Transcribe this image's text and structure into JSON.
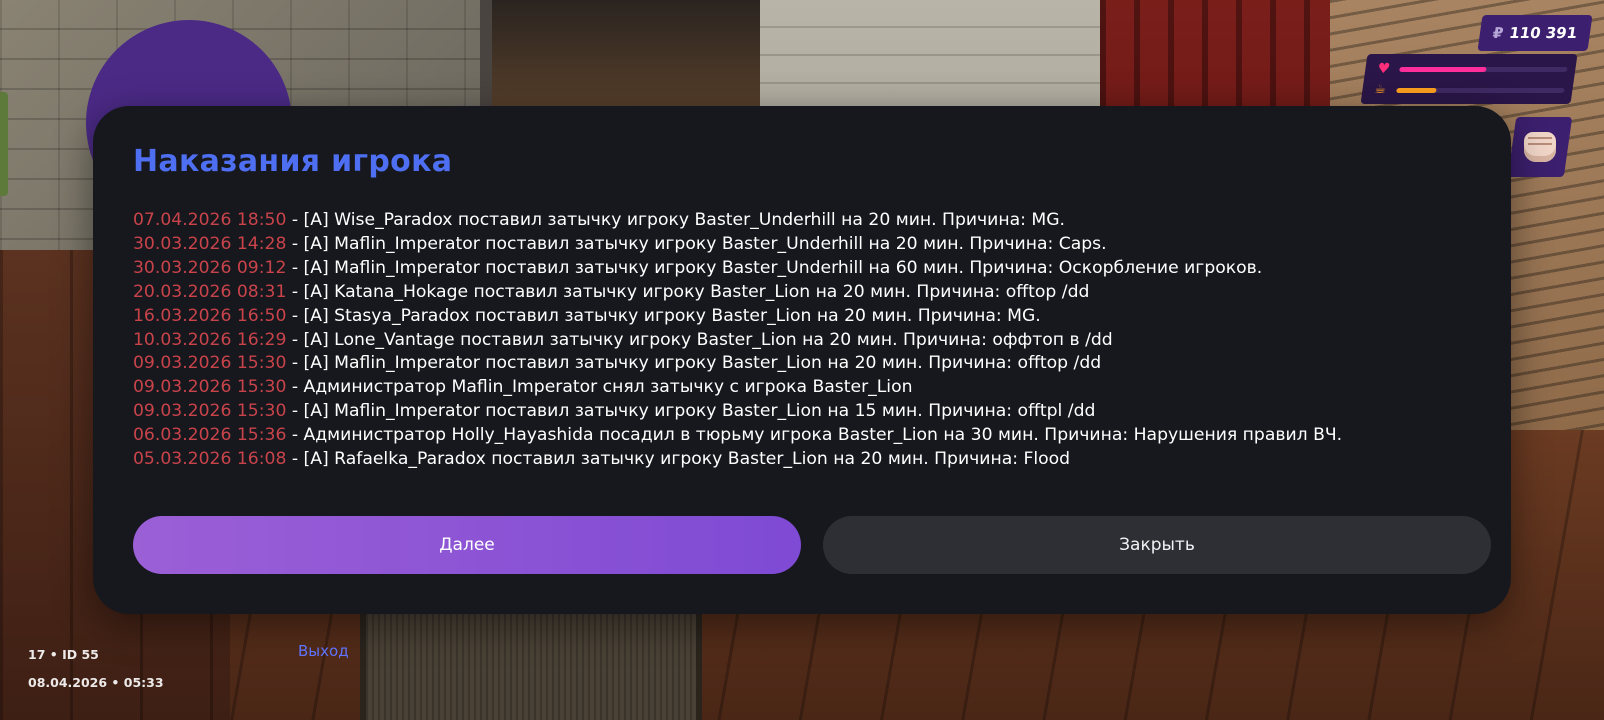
{
  "hud": {
    "currency_symbol": "₽",
    "money": "110 391",
    "health_fraction": 0.52,
    "hunger_fraction": 0.24,
    "colors": {
      "health": "#ff2e9a",
      "hunger": "#ffa11f",
      "hud_bg": "#3c1f6e"
    },
    "icons": [
      "heart-icon",
      "cup-icon",
      "fist-icon"
    ]
  },
  "modal": {
    "title": "Наказания игрока",
    "entries": [
      {
        "date": "07.04.2026 18:50",
        "text": " - [A] Wise_Paradox поставил затычку игроку Baster_Underhill на 20 мин. Причина: MG."
      },
      {
        "date": "30.03.2026 14:28",
        "text": " - [A] Maflin_Imperator поставил затычку игроку Baster_Underhill на 20 мин. Причина: Caps."
      },
      {
        "date": "30.03.2026 09:12",
        "text": " - [A] Maflin_Imperator поставил затычку игроку Baster_Underhill на 60 мин. Причина: Оскорбление игроков."
      },
      {
        "date": "20.03.2026 08:31",
        "text": " - [A] Katana_Hokage поставил затычку игроку Baster_Lion на 20 мин. Причина: offtop /dd"
      },
      {
        "date": "16.03.2026 16:50",
        "text": " - [A] Stasya_Paradox поставил затычку игроку Baster_Lion на 20 мин. Причина: MG."
      },
      {
        "date": "10.03.2026 16:29",
        "text": " - [A] Lone_Vantage поставил затычку игроку Baster_Lion на 20 мин. Причина: оффтоп в /dd"
      },
      {
        "date": "09.03.2026 15:30",
        "text": " - [A] Maflin_Imperator поставил затычку игроку Baster_Lion на 20 мин. Причина: offtop /dd"
      },
      {
        "date": "09.03.2026 15:30",
        "text": " - Администратор Maflin_Imperator снял затычку с игрока Baster_Lion"
      },
      {
        "date": "09.03.2026 15:30",
        "text": " - [A] Maflin_Imperator поставил затычку игроку Baster_Lion на 15 мин. Причина: offtpl /dd"
      },
      {
        "date": "06.03.2026 15:36",
        "text": " - Администратор Holly_Hayashida посадил в тюрьму игрока Baster_Lion на 30 мин. Причина: Нарушения правил ВЧ."
      },
      {
        "date": "05.03.2026 16:08",
        "text": " - [A] Rafaelka_Paradox поставил затычку игроку Baster_Lion на 20 мин. Причина: Flood"
      }
    ],
    "next_label": "Далее",
    "close_label": "Закрыть",
    "colors": {
      "title": "#4e6ff2",
      "date": "#c8434a",
      "accent": "#8a52d6",
      "background": "#17181e"
    }
  },
  "footer": {
    "player_line": "17 • ID 55",
    "datetime": "08.04.2026 • 05:33",
    "exit_label": "Выход"
  }
}
